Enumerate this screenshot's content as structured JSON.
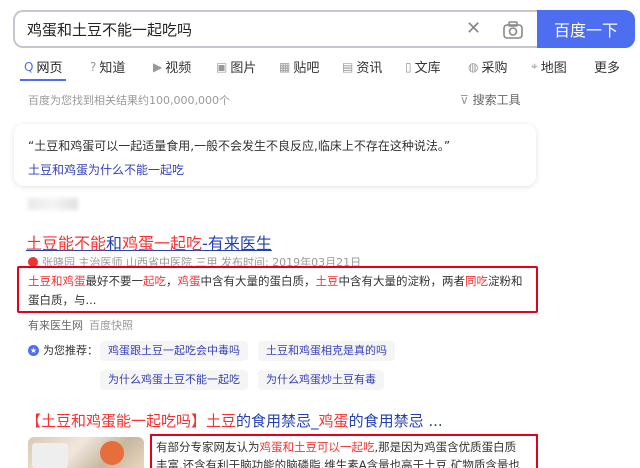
{
  "search": {
    "query": "鸡蛋和土豆不能一起吃吗",
    "button_label": "百度一下"
  },
  "tabs": [
    {
      "icon": "search-icon",
      "label": "网页"
    },
    {
      "icon": "question-icon",
      "label": "知道"
    },
    {
      "icon": "video-icon",
      "label": "视频"
    },
    {
      "icon": "image-icon",
      "label": "图片"
    },
    {
      "icon": "post-icon",
      "label": "贴吧"
    },
    {
      "icon": "news-icon",
      "label": "资讯"
    },
    {
      "icon": "doc-icon",
      "label": "文库"
    },
    {
      "icon": "shop-icon",
      "label": "采购"
    },
    {
      "icon": "map-icon",
      "label": "地图"
    },
    {
      "icon": "",
      "label": "更多"
    }
  ],
  "result_count": "百度为您找到相关结果约100,000,000个",
  "tools_label": "搜索工具",
  "answer": {
    "text": "“土豆和鸡蛋可以一起适量食用,一般不会发生不良反应,临床上不存在这种说法。”",
    "link": "土豆和鸡蛋为什么不能一起吃"
  },
  "result1": {
    "title": {
      "p1": "土豆能不能",
      "p2": "和",
      "p3": "鸡蛋一起吃",
      "p4": "-有来医生"
    },
    "meta": "张晓园 主治医师 山西省中医院 三甲 发布时间: 2019年03月21日",
    "snippet": {
      "s1": "土豆和鸡蛋",
      "s2": "最好不要一",
      "s3": "起吃",
      "s4": "，",
      "s5": "鸡蛋",
      "s6": "中含有大量的蛋白质，",
      "s7": "土豆",
      "s8": "中含有大量的淀粉，两者",
      "s9": "同吃",
      "s10": "淀粉和",
      "s11": "蛋白质，与..."
    },
    "source": "有来医生网",
    "snapshot": "百度快照"
  },
  "recommend": {
    "label": "为您推荐：",
    "chips": [
      "鸡蛋跟土豆一起吃会中毒吗",
      "土豆和鸡蛋相克是真的吗",
      "为什么鸡蛋土豆不能一起吃",
      "为什么鸡蛋炒土豆有毒"
    ]
  },
  "result2": {
    "title": {
      "p1": "【土豆和鸡蛋能一起吃吗】",
      "p2": "土豆",
      "p3": "的食用禁忌_",
      "p4": "鸡蛋",
      "p5": "的食用禁忌 ..."
    },
    "snippet": {
      "s1": "有部分专家网友认为",
      "s2": "鸡蛋和土豆可以一起吃",
      "s3": ",那是因为鸡蛋含优质蛋白质",
      "s4": "丰富,还含有利于脑功能的脑磷脂,维生素A含量也高于土豆,矿物质含量也"
    }
  }
}
